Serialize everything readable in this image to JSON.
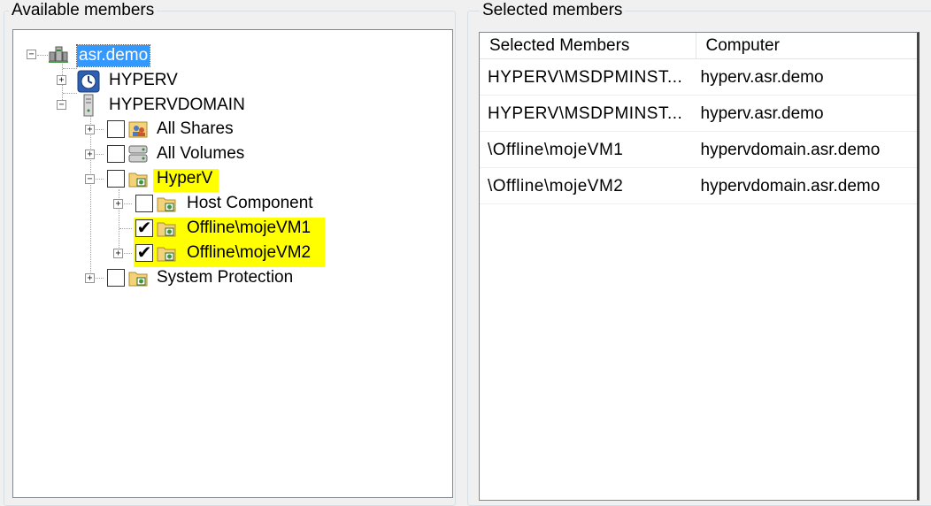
{
  "left_group": {
    "title": "Available members"
  },
  "right_group": {
    "title": "Selected members"
  },
  "tree": {
    "root": {
      "label": "asr.demo",
      "expander": "−"
    },
    "hyperv": {
      "label": "HYPERV",
      "expander": "+"
    },
    "hypervdomain": {
      "label": "HYPERVDOMAIN",
      "expander": "−"
    },
    "all_shares": {
      "label": "All Shares",
      "expander": "+",
      "checked": ""
    },
    "all_volumes": {
      "label": "All Volumes",
      "expander": "+",
      "checked": ""
    },
    "hyperv_node": {
      "label": "HyperV",
      "expander": "−",
      "checked": ""
    },
    "host_component": {
      "label": "Host Component",
      "expander": "+",
      "checked": ""
    },
    "vm1": {
      "label": "Offline\\mojeVM1",
      "checked": "✔"
    },
    "vm2": {
      "label": "Offline\\mojeVM2",
      "expander": "+",
      "checked": "✔"
    },
    "system_protection": {
      "label": "System Protection",
      "expander": "+",
      "checked": ""
    }
  },
  "list": {
    "columns": [
      "Selected Members",
      "Computer"
    ],
    "rows": [
      [
        "HYPERV\\MSDPMINST...",
        "hyperv.asr.demo"
      ],
      [
        "HYPERV\\MSDPMINST...",
        "hyperv.asr.demo"
      ],
      [
        "\\Offline\\mojeVM1",
        "hypervdomain.asr.demo"
      ],
      [
        "\\Offline\\mojeVM2",
        "hypervdomain.asr.demo"
      ]
    ]
  },
  "colors": {
    "selection": "#3399ff",
    "highlight": "#ffff00",
    "background": "#f0f0f0"
  }
}
